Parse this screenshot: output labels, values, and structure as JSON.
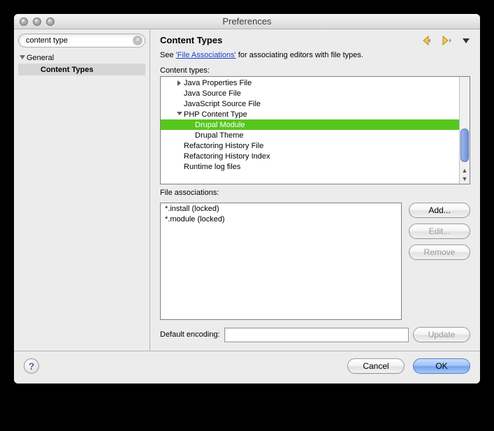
{
  "window": {
    "title": "Preferences"
  },
  "sidebar": {
    "search_value": "content type",
    "items": [
      {
        "label": "General",
        "expanded": true,
        "selected": false
      },
      {
        "label": "Content Types",
        "selected": true
      }
    ]
  },
  "main": {
    "title": "Content Types",
    "intro_prefix": "See ",
    "intro_link": "'File Associations'",
    "intro_suffix": " for associating editors with file types.",
    "content_types_label": "Content types:",
    "file_assoc_label": "File associations:",
    "default_encoding_label": "Default encoding:",
    "default_encoding_value": ""
  },
  "content_types": [
    {
      "label": "Java Properties File",
      "indent": 1,
      "tri": "right",
      "selected": false
    },
    {
      "label": "Java Source File",
      "indent": 1,
      "tri": "none",
      "selected": false
    },
    {
      "label": "JavaScript Source File",
      "indent": 1,
      "tri": "none",
      "selected": false
    },
    {
      "label": "PHP Content Type",
      "indent": 1,
      "tri": "down",
      "selected": false
    },
    {
      "label": "Drupal Module",
      "indent": 2,
      "tri": "none",
      "selected": true
    },
    {
      "label": "Drupal Theme",
      "indent": 2,
      "tri": "none",
      "selected": false
    },
    {
      "label": "Refactoring History File",
      "indent": 1,
      "tri": "none",
      "selected": false
    },
    {
      "label": "Refactoring History Index",
      "indent": 1,
      "tri": "none",
      "selected": false
    },
    {
      "label": "Runtime log files",
      "indent": 1,
      "tri": "none",
      "selected": false
    }
  ],
  "file_associations": [
    {
      "label": "*.install (locked)"
    },
    {
      "label": "*.module (locked)"
    }
  ],
  "buttons": {
    "add": "Add...",
    "edit": "Edit...",
    "remove": "Remove",
    "update": "Update",
    "cancel": "Cancel",
    "ok": "OK"
  }
}
